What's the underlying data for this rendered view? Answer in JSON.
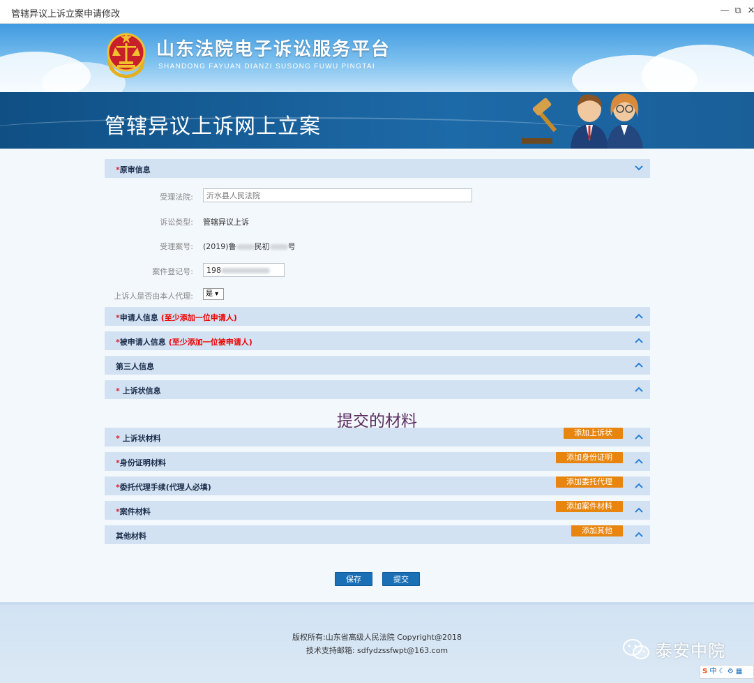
{
  "window": {
    "title": "管辖异议上诉立案申请修改",
    "controls": [
      "—",
      "⧉",
      "✕"
    ]
  },
  "header": {
    "site_title": "山东法院电子诉讼服务平台",
    "site_subtitle": "SHANDONG FAYUAN DIANZI SUSONG FUWU PINGTAI",
    "page_heading": "管辖异议上诉网上立案"
  },
  "sections": {
    "original": {
      "req": "*",
      "label": "原审信息"
    },
    "applicant": {
      "req": "*",
      "label": "申请人信息",
      "note": "(至少添加一位申请人)"
    },
    "respondent": {
      "req": "*",
      "label": "被申请人信息",
      "note": "(至少添加一位被申请人)"
    },
    "third_party": {
      "label": "第三人信息"
    },
    "appeal_info": {
      "req": "* ",
      "label": "上诉状信息"
    }
  },
  "fields": {
    "court": {
      "label": "受理法院:",
      "value": "沂水县人民法院"
    },
    "case_type": {
      "label": "诉讼类型:",
      "value": "管辖异议上诉"
    },
    "case_number": {
      "label": "受理案号:",
      "prefix": "(2019)鲁",
      "middle": "民初",
      "suffix": "号"
    },
    "registration_no": {
      "label": "案件登记号:",
      "value": "198"
    },
    "self_agent": {
      "label": "上诉人是否由本人代理:",
      "value": "是"
    }
  },
  "materials": {
    "title": "提交的材料",
    "items": [
      {
        "req": "* ",
        "label": "上诉状材料",
        "button": "添加上诉状"
      },
      {
        "req": "*",
        "label": "身份证明材料",
        "button": "添加身份证明"
      },
      {
        "req": "*",
        "label": "委托代理手续(代理人必填)",
        "button": "添加委托代理"
      },
      {
        "req": "*",
        "label": "案件材料",
        "button": "添加案件材料"
      },
      {
        "req": "",
        "label": "其他材料",
        "button": "添加其他"
      }
    ]
  },
  "actions": {
    "save": "保存",
    "submit": "提交"
  },
  "footer": {
    "copyright": "版权所有:山东省高级人民法院 Copyright@2018",
    "support": "技术支持邮箱:  sdfydzssfwpt@163.com",
    "watermark": "泰安中院",
    "tray_text": "中"
  },
  "colors": {
    "section_bg": "#d3e2f3",
    "header_band": "#1d6aa8",
    "add_button": "#e8850f",
    "primary_button": "#1a6fb5",
    "required": "#d9232e",
    "materials_title": "#5c2e61"
  }
}
